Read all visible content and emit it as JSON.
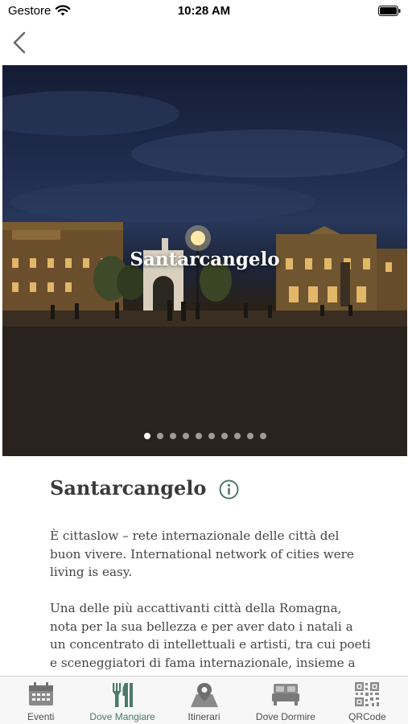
{
  "status_bar": {
    "carrier": "Gestore",
    "time": "10:28 AM"
  },
  "hero": {
    "title": "Santarcangelo",
    "slide_count": 10,
    "active_slide": 1
  },
  "place": {
    "title": "Santarcangelo",
    "paragraphs": [
      "È cittaslow – rete internazionale delle città del buon vivere. International network of cities were living is easy.",
      "Una delle più accattivanti città della Romagna, nota per la sua bellezza e per aver dato i natali a un concentrato di intellettuali e artisti, tra cui poeti e sceneggiatori di fama internazionale, insieme a una ricca e variegata cultura di tradizioni popolari."
    ]
  },
  "tab_bar": {
    "tabs": [
      {
        "label": "Eventi",
        "icon": "calendar-icon"
      },
      {
        "label": "Dove Mangiare",
        "icon": "fork-knife-icon"
      },
      {
        "label": "Itinerari",
        "icon": "map-pin-icon"
      },
      {
        "label": "Dove Dormire",
        "icon": "bed-icon"
      },
      {
        "label": "QRCode",
        "icon": "qrcode-icon"
      }
    ],
    "active": "Dove Mangiare"
  },
  "colors": {
    "accent": "#4a7a68",
    "tab_inactive": "#8a8a8a"
  }
}
